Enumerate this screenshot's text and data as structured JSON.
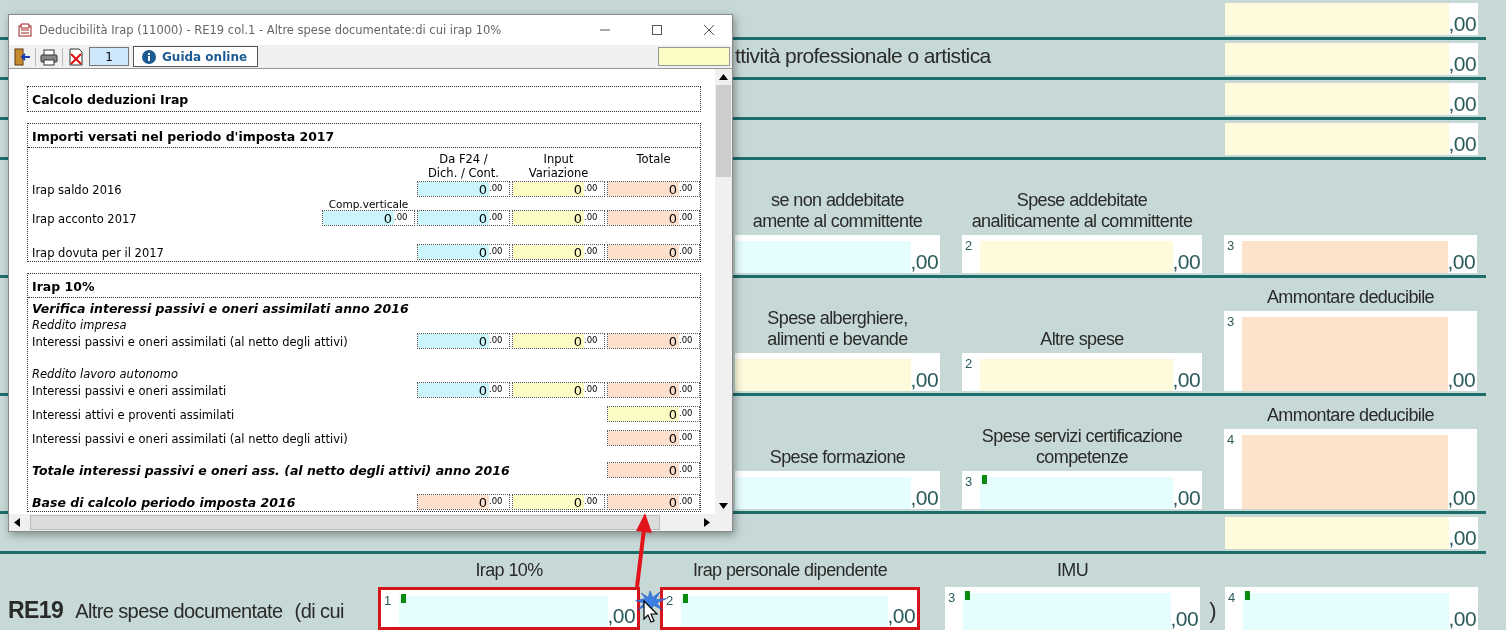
{
  "form": {
    "rows": [
      {
        "kind": "single",
        "value": ",00"
      },
      {
        "kind": "single",
        "label": "ttività professionale o artistica",
        "value": ",00"
      },
      {
        "kind": "single",
        "value": ",00"
      },
      {
        "kind": "single",
        "value": ",00"
      },
      {
        "kind": "columns",
        "columns": [
          {
            "header": "se non addebitate\namente al committente",
            "value": ",00",
            "color": "#e6fdfd",
            "tall": false,
            "marked": false
          },
          {
            "header": "Spese addebitate\nanaliticamente al committente",
            "number": "2",
            "value": ",00",
            "color": "#fdfbdc",
            "tall": false,
            "marked": false
          },
          {
            "number": "3",
            "value": ",00",
            "color": "#fde3cc",
            "tall": false,
            "marked": false
          }
        ]
      },
      {
        "kind": "columns",
        "columns": [
          {
            "header": "Spese alberghiere,\nalimenti e bevande",
            "value": ",00",
            "color": "#fdfbdc",
            "tall": false,
            "marked": false
          },
          {
            "header": "Altre spese",
            "number": "2",
            "value": ",00",
            "color": "#fdfbdc",
            "tall": false,
            "marked": false
          },
          {
            "header": "Ammontare deducibile",
            "number": "3",
            "value": ",00",
            "color": "#fde3cc",
            "tall": true,
            "marked": false
          }
        ]
      },
      {
        "kind": "columns",
        "columns": [
          {
            "header": "Spese formazione",
            "value": ",00",
            "color": "#e6fdfd",
            "tall": false,
            "marked": false
          },
          {
            "header": "Spese servizi certificazione\ncompetenze",
            "number": "3",
            "value": ",00",
            "color": "#e6fdfd",
            "tall": false,
            "marked": true
          },
          {
            "header": "Ammontare deducibile",
            "number": "4",
            "value": ",00",
            "color": "#fde3cc",
            "tall": true,
            "marked": false
          }
        ]
      },
      {
        "kind": "single",
        "value": ",00"
      },
      {
        "kind": "line",
        "code": "RE19",
        "label": "Altre spese documentate",
        "prefix": "(di cui",
        "suffix": ")",
        "fields": [
          {
            "header": "Irap 10%",
            "number": "1",
            "value": ",00",
            "color": "#e6fdfd",
            "marked": true,
            "highlighted": true
          },
          {
            "header": "Irap personale dipendente",
            "number": "2",
            "value": ",00",
            "color": "#e6fdfd",
            "marked": true,
            "highlighted": true
          },
          {
            "header": "IMU",
            "number": "3",
            "value": ",00",
            "color": "#e6fdfd",
            "marked": true,
            "highlighted": false
          },
          {
            "number": "4",
            "value": ",00",
            "color": "#e6fdfd",
            "marked": true,
            "highlighted": false
          }
        ]
      }
    ]
  },
  "dialog": {
    "title": "Deducibilità Irap (11000) - RE19 col.1 - Altre spese documentate:di cui irap 10%",
    "page": "1",
    "help": "Guida online",
    "sections": [
      {
        "rows": [
          {
            "kind": "heading",
            "text": "Calcolo deduzioni Irap"
          }
        ]
      },
      {
        "rows": [
          {
            "kind": "heading",
            "text": "Importi versati nel periodo d'imposta 2017"
          },
          {
            "kind": "headers",
            "headers": [
              "Da F24 /\nDich. / Cont.",
              "Input\nVariazione",
              "Totale"
            ]
          },
          {
            "kind": "amount",
            "label": "Irap saldo 2016",
            "cells": [
              {
                "value": "0",
                "decimals": ".00",
                "color": "#c9f5fb"
              },
              {
                "value": "0",
                "decimals": ".00",
                "color": "#fdfcc4"
              },
              {
                "value": "0",
                "decimals": ".00",
                "color": "#fde0cc"
              }
            ]
          },
          {
            "kind": "amount",
            "label": "Irap acconto 2017",
            "extra": {
              "caption": "Comp.verticale",
              "cell": {
                "value": "0",
                "decimals": ".00",
                "color": "#c9f5fb"
              }
            },
            "cells": [
              {
                "value": "0",
                "decimals": ".00",
                "color": "#c9f5fb"
              },
              {
                "value": "0",
                "decimals": ".00",
                "color": "#fdfcc4"
              },
              {
                "value": "0",
                "decimals": ".00",
                "color": "#fde0cc"
              }
            ]
          },
          {
            "kind": "amount",
            "label": "Irap dovuta per il 2017",
            "cells": [
              {
                "value": "0",
                "decimals": ".00",
                "color": "#c9f5fb"
              },
              {
                "value": "0",
                "decimals": ".00",
                "color": "#fdfcc4"
              },
              {
                "value": "0",
                "decimals": ".00",
                "color": "#fde0cc"
              }
            ]
          }
        ]
      },
      {
        "rows": [
          {
            "kind": "heading",
            "text": "Irap 10%"
          },
          {
            "kind": "subheading",
            "text": "Verifica interessi passivi e oneri assimilati anno 2016"
          },
          {
            "kind": "note",
            "text": "Reddito impresa"
          },
          {
            "kind": "amount",
            "label": "Interessi passivi e oneri assimilati (al netto degli attivi)",
            "cells": [
              {
                "value": "0",
                "decimals": ".00",
                "color": "#c9f5fb"
              },
              {
                "value": "0",
                "decimals": ".00",
                "color": "#fdfcc4"
              },
              {
                "value": "0",
                "decimals": ".00",
                "color": "#fde0cc"
              }
            ]
          },
          {
            "kind": "note",
            "text": "Reddito lavoro autonomo"
          },
          {
            "kind": "amount",
            "label": "Interessi passivi e oneri assimilati",
            "cells": [
              {
                "value": "0",
                "decimals": ".00",
                "color": "#c9f5fb"
              },
              {
                "value": "0",
                "decimals": ".00",
                "color": "#fdfcc4"
              },
              {
                "value": "0",
                "decimals": ".00",
                "color": "#fde0cc"
              }
            ]
          },
          {
            "kind": "amount",
            "label": "Interessi attivi e proventi assimilati",
            "cells": [
              {
                "value": "0",
                "decimals": ".00",
                "color": "#fdfcc4"
              }
            ]
          },
          {
            "kind": "amount",
            "label": "Interessi passivi e oneri assimilati (al netto degli attivi)",
            "cells": [
              {
                "value": "0",
                "decimals": ".00",
                "color": "#fde0cc"
              }
            ]
          },
          {
            "kind": "total",
            "label": "Totale interessi passivi e oneri ass. (al netto degli attivi) anno 2016",
            "cells": [
              {
                "value": "0",
                "decimals": ".00",
                "color": "#fde0cc"
              }
            ]
          },
          {
            "kind": "total",
            "label": "Base di calcolo periodo imposta 2016",
            "cells": [
              {
                "value": "0",
                "decimals": ".00",
                "color": "#fde0cc"
              },
              {
                "value": "0",
                "decimals": ".00",
                "color": "#fdfcc4"
              },
              {
                "value": "0",
                "decimals": ".00",
                "color": "#fde0cc"
              }
            ]
          }
        ]
      }
    ]
  }
}
